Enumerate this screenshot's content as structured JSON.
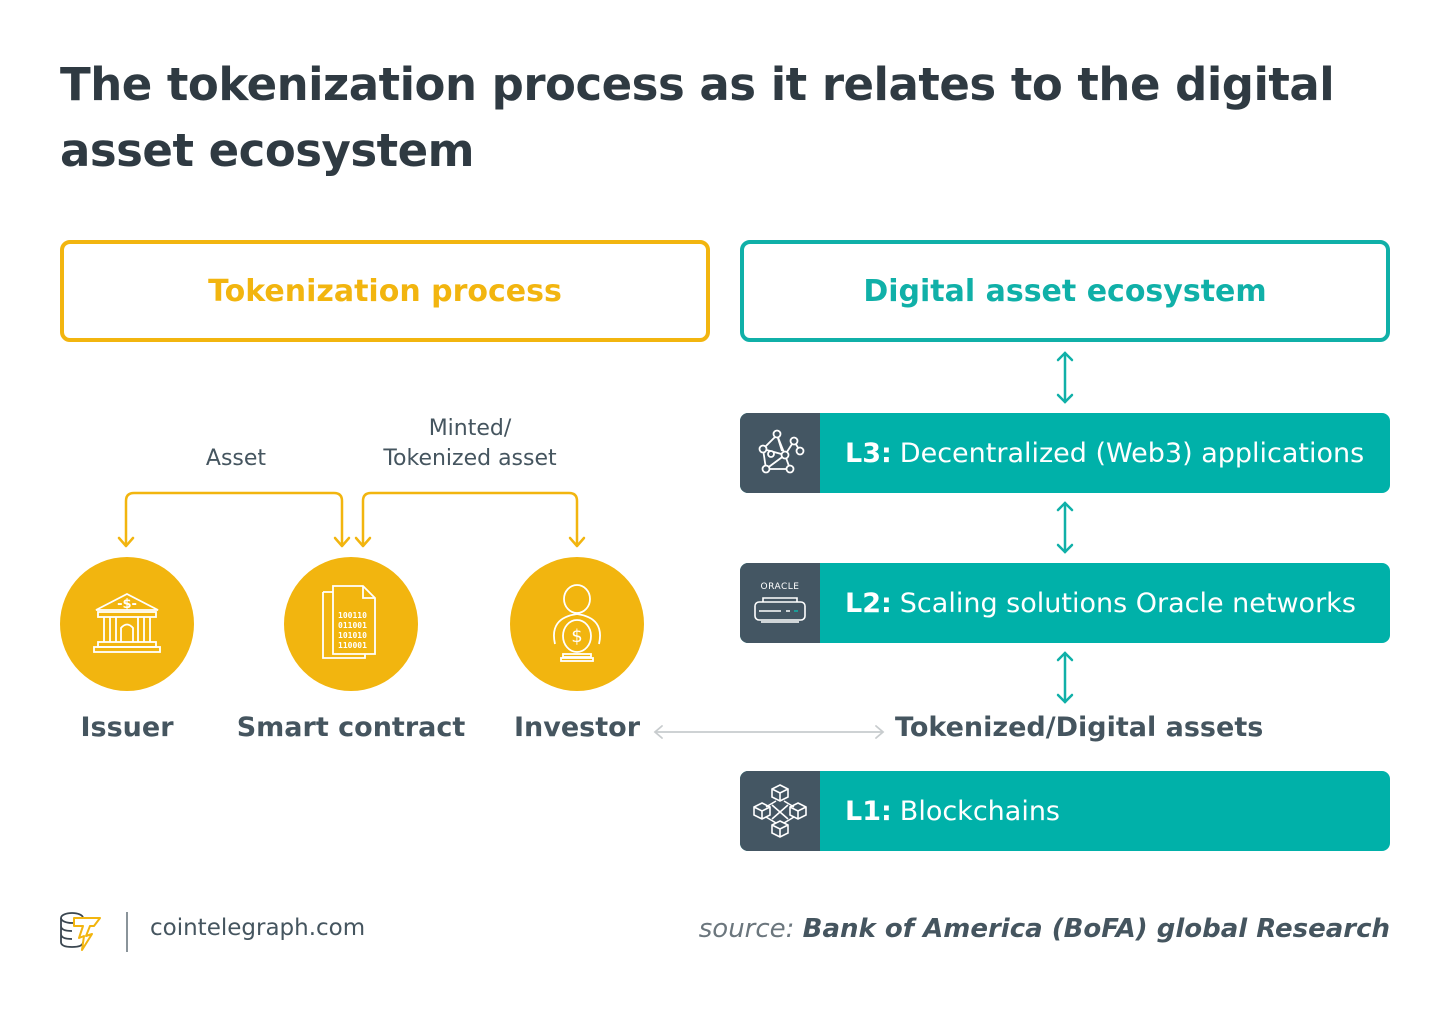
{
  "title": "The tokenization process as it relates to the digital asset ecosystem",
  "left_panel": {
    "header": "Tokenization process",
    "flows": [
      {
        "label": "Asset",
        "from": "Smart contract",
        "to": "Issuer"
      },
      {
        "label": "Minted/\nTokenized asset",
        "from": "Smart contract",
        "to": "Investor"
      }
    ],
    "flow_label_asset": "Asset",
    "flow_label_minted_line1": "Minted/",
    "flow_label_minted_line2": "Tokenized asset",
    "nodes": [
      {
        "label": "Issuer",
        "icon": "bank-icon"
      },
      {
        "label": "Smart contract",
        "icon": "binary-document-icon"
      },
      {
        "label": "Investor",
        "icon": "investor-coin-icon"
      }
    ]
  },
  "right_panel": {
    "header": "Digital asset ecosystem",
    "layers": [
      {
        "code": "L3:",
        "label": "Decentralized (Web3) applications",
        "icon": "network-nodes-icon"
      },
      {
        "code": "L2:",
        "label": "Scaling solutions Oracle networks",
        "icon": "oracle-server-icon",
        "icon_caption": "ORACLE"
      },
      {
        "code": "L1:",
        "label": "Blockchains",
        "icon": "blockchain-cubes-icon"
      }
    ],
    "tokenized_label": "Tokenized/Digital assets"
  },
  "colors": {
    "yellow": "#f2b50f",
    "teal": "#00b1a9",
    "slate": "#445663",
    "text": "#45555f"
  },
  "footer": {
    "site": "cointelegraph.com",
    "source_label": "source:",
    "source_value": "Bank of America (BoFA) global Research"
  }
}
